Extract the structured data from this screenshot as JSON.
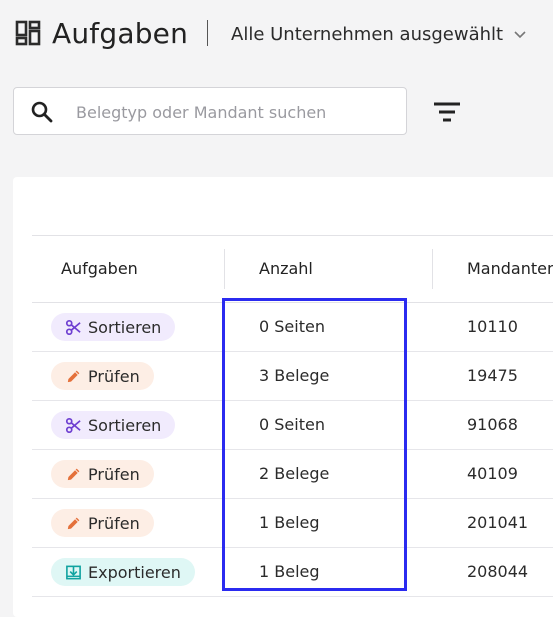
{
  "header": {
    "title": "Aufgaben",
    "company_selector": "Alle Unternehmen ausgewählt",
    "icons": {
      "app": "dashboard-grid-icon",
      "dropdown": "chevron-down-icon"
    }
  },
  "search": {
    "placeholder": "Belegtyp oder Mandant suchen",
    "value": "",
    "icon": "search-icon",
    "filter_icon": "filter-icon"
  },
  "table": {
    "columns": [
      "Aufgaben",
      "Anzahl",
      "Mandanten"
    ],
    "rows": [
      {
        "task": "Sortieren",
        "task_type": "sort",
        "icon": "scissors-icon",
        "count": "0 Seiten",
        "client": "10110"
      },
      {
        "task": "Prüfen",
        "task_type": "check",
        "icon": "pencil-icon",
        "count": "3 Belege",
        "client": "19475"
      },
      {
        "task": "Sortieren",
        "task_type": "sort",
        "icon": "scissors-icon",
        "count": "0 Seiten",
        "client": "91068"
      },
      {
        "task": "Prüfen",
        "task_type": "check",
        "icon": "pencil-icon",
        "count": "2 Belege",
        "client": "40109"
      },
      {
        "task": "Prüfen",
        "task_type": "check",
        "icon": "pencil-icon",
        "count": "1 Beleg",
        "client": "201041"
      },
      {
        "task": "Exportieren",
        "task_type": "export",
        "icon": "export-download-icon",
        "count": "1 Beleg",
        "client": "208044"
      }
    ]
  },
  "colors": {
    "sort_chip_bg": "#f1ebfd",
    "sort_chip_icon": "#6e3fd1",
    "check_chip_bg": "#fdeee5",
    "check_chip_icon": "#e4703a",
    "export_chip_bg": "#dff7f5",
    "export_chip_icon": "#11a3a0",
    "highlight": "#2b2bf0"
  }
}
